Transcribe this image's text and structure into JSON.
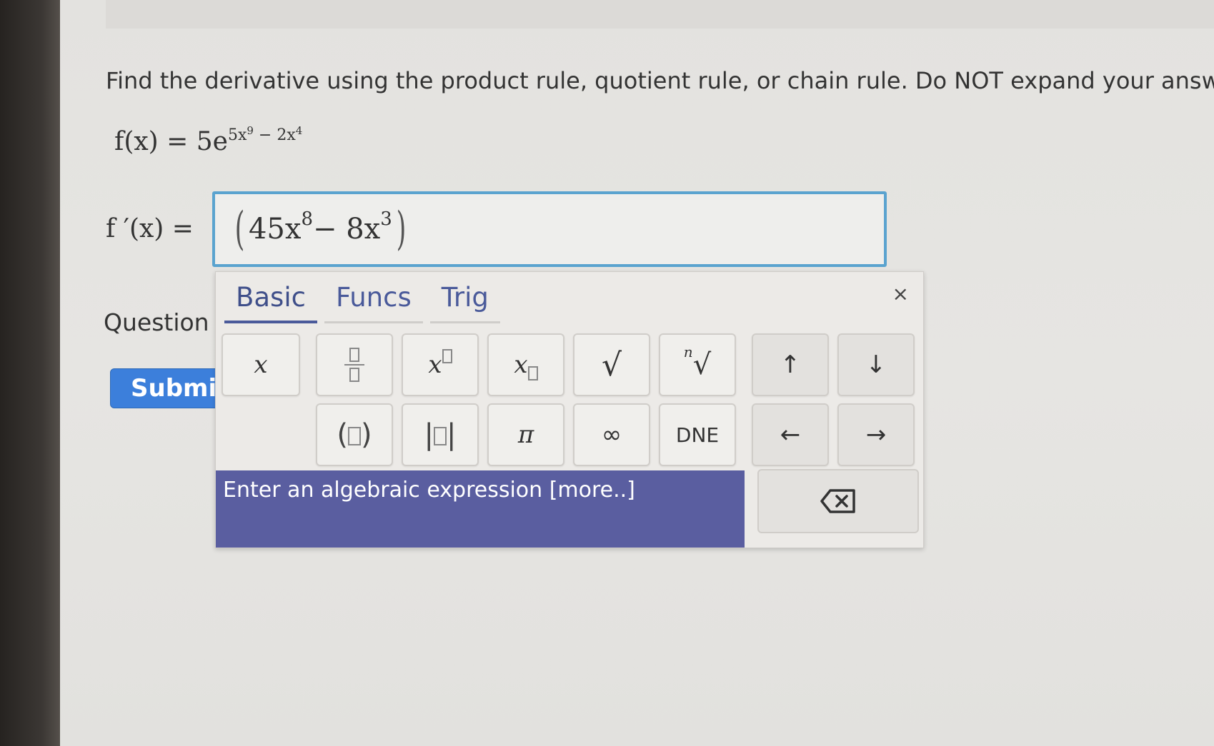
{
  "prompt": "Find the derivative using the product rule, quotient rule, or chain rule. Do NOT expand your answer.",
  "function": {
    "lhs": "f(x) = 5e",
    "exponent_main": "5x",
    "exponent_power1": "9",
    "exponent_mid": " − 2x",
    "exponent_power2": "4"
  },
  "derivative": {
    "label": "f ′(x) =",
    "coefficient1": "45x",
    "power1": "8",
    "operator": " − 8x",
    "power2": "3"
  },
  "question_label": "Question I",
  "submit_label": "Submit",
  "keypad": {
    "tabs": [
      {
        "label": "Basic",
        "active": true
      },
      {
        "label": "Funcs",
        "active": false
      },
      {
        "label": "Trig",
        "active": false
      }
    ],
    "close_label": "×",
    "keys": {
      "x": "x",
      "pi": "π",
      "infinity": "∞",
      "dne": "DNE",
      "up": "↑",
      "down": "↓",
      "left": "←",
      "right": "→",
      "nth_root_index": "n",
      "sqrt": "√"
    },
    "hint": "Enter an algebraic expression [more..]"
  }
}
